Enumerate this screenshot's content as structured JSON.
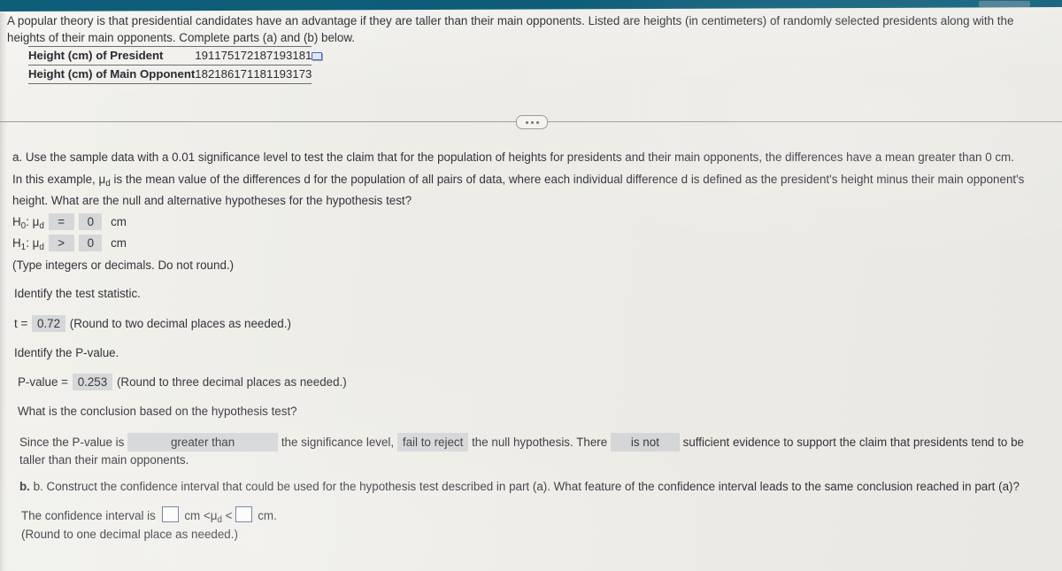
{
  "intro": {
    "text": "A popular theory is that presidential candidates have an advantage if they are taller than their main opponents. Listed are heights (in centimeters) of randomly selected presidents along with the heights of their main opponents. Complete parts (a) and (b) below."
  },
  "data_table": {
    "rows": [
      {
        "label": "Height (cm) of President",
        "values": [
          "191",
          "175",
          "172",
          "187",
          "193",
          "181"
        ]
      },
      {
        "label": "Height (cm) of Main Opponent",
        "values": [
          "182",
          "186",
          "171",
          "181",
          "193",
          "173"
        ]
      }
    ],
    "icon": "popout-window-icon"
  },
  "divider": {
    "icon": "ellipsis-icon"
  },
  "part_a": {
    "prompt": "a. Use the sample data with a 0.01 significance level to test the claim that for the population of heights for presidents and their main opponents, the differences have a mean greater than 0 cm.",
    "mu_paragraph_1": "In this example, ",
    "mu_symbol": "μ",
    "mu_sub": "d",
    "mu_paragraph_2": " is the mean value of the differences d for the population of all pairs of data, where each individual difference d is defined as the president's height minus their main opponent's height. What are the null and alternative hypotheses for the hypothesis test?",
    "h0_label": "H",
    "h0_sub": "0",
    "h1_label": "H",
    "h1_sub": "1",
    "h0_operator": "=",
    "h0_value": "0",
    "h0_unit": "cm",
    "h1_operator": ">",
    "h1_value": "0",
    "h1_unit": "cm",
    "hyp_note": "(Type integers or decimals. Do not round.)",
    "identify_statistic": "Identify the test statistic.",
    "t_label": "t =",
    "t_value": "0.72",
    "t_note": "(Round to two decimal places as needed.)",
    "identify_pvalue": "Identify the P-value.",
    "p_label": "P-value =",
    "p_value": "0.253",
    "p_note": "(Round to three decimal places as needed.)",
    "conclusion_question": "What is the conclusion based on the hypothesis test?",
    "conclusion_pre": "Since the P-value is",
    "conclusion_compare": "greater than",
    "conclusion_mid1": "the significance level,",
    "conclusion_decision": "fail to reject",
    "conclusion_mid2": "the null hypothesis. There",
    "conclusion_evidence": "is not",
    "conclusion_post": "sufficient evidence to support the claim that presidents tend to be taller than their main opponents."
  },
  "part_b": {
    "prompt": "b. Construct the confidence interval that could be used for the hypothesis test described in part (a). What feature of the confidence interval leads to the same conclusion reached in part (a)?",
    "ci_pre": "The confidence interval is",
    "ci_lower_value": "",
    "ci_unit_1": "cm <",
    "ci_mu": "μ",
    "ci_mu_sub": "d",
    "ci_lt": "<",
    "ci_upper_value": "",
    "ci_unit_2": "cm.",
    "ci_note": "(Round to one decimal place as needed.)"
  },
  "colors": {
    "background": "#efeeea",
    "answer_box": "#d6d7d8",
    "top_band": "#0d5d78",
    "input_border": "#5c6b93",
    "text": "#33333c"
  }
}
